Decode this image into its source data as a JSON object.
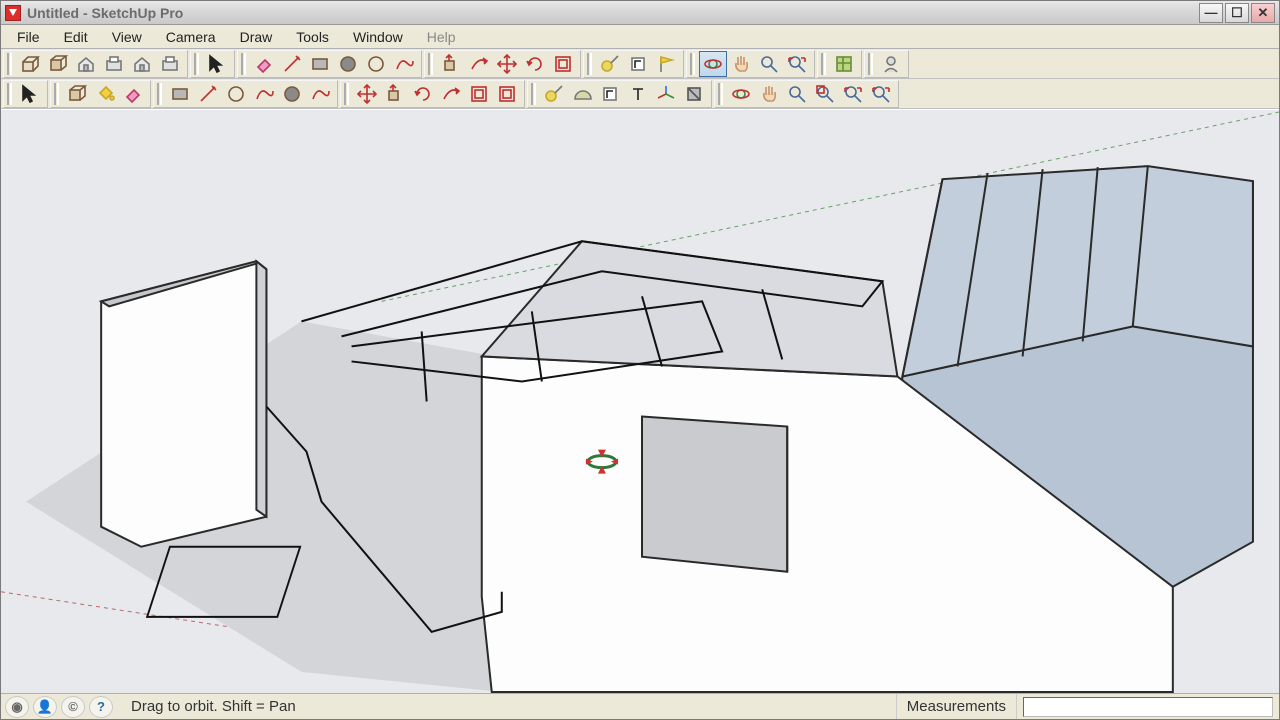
{
  "title": "Untitled - SketchUp Pro",
  "menu": {
    "file": "File",
    "edit": "Edit",
    "view": "View",
    "camera": "Camera",
    "draw": "Draw",
    "tools": "Tools",
    "window": "Window",
    "help": "Help"
  },
  "toolbar_row1": {
    "groups": [
      {
        "tools": [
          "model-icon",
          "component-icon",
          "house-icon",
          "print-icon",
          "house-plus-icon",
          "box-icon"
        ]
      },
      {
        "tools": [
          "select-arrow-icon"
        ]
      },
      {
        "tools": [
          "eraser-icon",
          "pencil-icon",
          "rectangle-icon",
          "circle-filled-icon",
          "circle-outline-icon",
          "freehand-icon"
        ]
      },
      {
        "tools": [
          "pushpull-icon",
          "followme-1-icon",
          "move-icon",
          "rotate-icon",
          "offset-icon"
        ]
      },
      {
        "tools": [
          "tape-icon",
          "text-dim-icon",
          "yellow-flag-icon"
        ]
      },
      {
        "tools": [
          "orbit-icon",
          "pan-icon",
          "zoom-icon",
          "zoom-extents-icon"
        ]
      },
      {
        "tools": [
          "map-icon"
        ]
      },
      {
        "tools": [
          "instructor-icon"
        ]
      }
    ],
    "active_tool_index": [
      5,
      0
    ]
  },
  "toolbar_row2": {
    "groups": [
      {
        "tools": [
          "select-arrow-2-icon"
        ]
      },
      {
        "tools": [
          "component-2-icon",
          "paintbucket-icon",
          "eraser-2-icon"
        ]
      },
      {
        "tools": [
          "rectangle-2-icon",
          "line-icon",
          "circle-2-icon",
          "arc-icon",
          "polygon-icon",
          "freehand-2-icon"
        ]
      },
      {
        "tools": [
          "move-2-icon",
          "pushpull-2-icon",
          "rotate-2-icon",
          "followme-2-icon",
          "scale-icon",
          "offset-2-icon"
        ]
      },
      {
        "tools": [
          "tape-2-icon",
          "protractor-icon",
          "dimension-icon",
          "text-icon",
          "axes-icon",
          "section-icon"
        ]
      },
      {
        "tools": [
          "orbit-2-icon",
          "pan-2-icon",
          "zoom-2-icon",
          "zoom-window-icon",
          "zoom-extents-2-icon",
          "previous-icon"
        ]
      }
    ]
  },
  "status": {
    "hint": "Drag to orbit.  Shift = Pan",
    "measurements_label": "Measurements"
  }
}
